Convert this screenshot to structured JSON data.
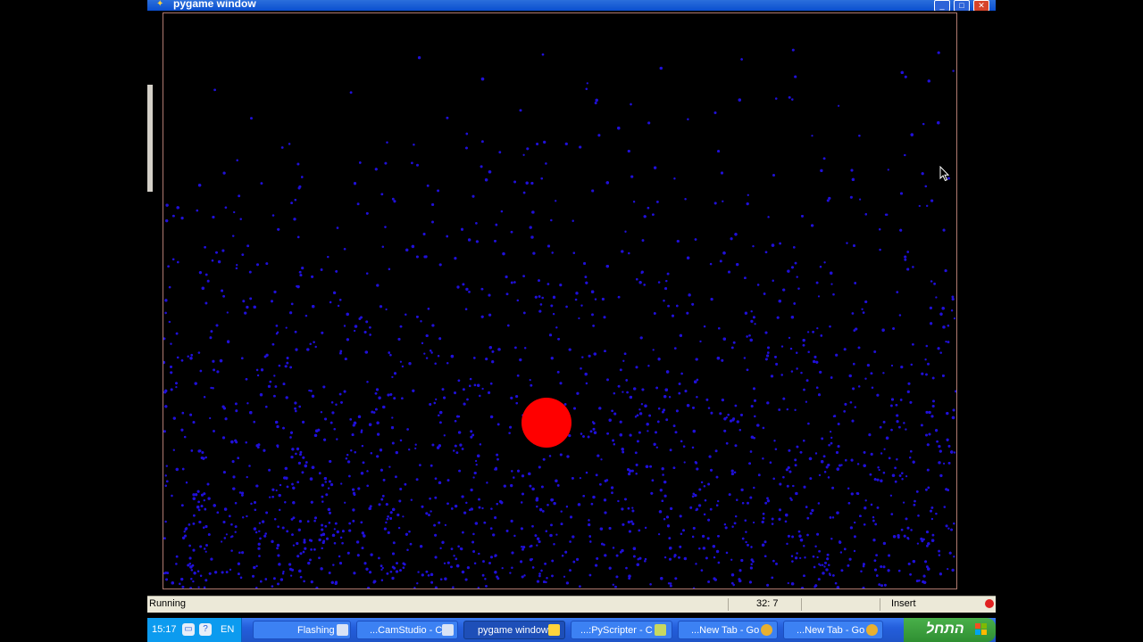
{
  "window": {
    "title": "pygame window",
    "controls": [
      "minimize",
      "maximize",
      "close"
    ]
  },
  "game": {
    "background": "#000000",
    "particle_color": "#2010d8",
    "ball_color": "#ff0000",
    "icons": {
      "cursor": "arrow-cursor-icon",
      "ball": "red-ball"
    }
  },
  "statusbar": {
    "state": "Running",
    "position": "32: 7",
    "mode": "Insert"
  },
  "taskbar": {
    "clock": "15:17",
    "language": "EN",
    "start_label": "התחל",
    "buttons": [
      {
        "label": "Flashing",
        "active": false
      },
      {
        "label": "...CamStudio - C",
        "active": false
      },
      {
        "label": "pygame window",
        "active": true
      },
      {
        "label": "...:PyScripter - C",
        "active": false
      },
      {
        "label": "...New Tab - Go",
        "active": false
      },
      {
        "label": "...New Tab - Go",
        "active": false
      }
    ]
  }
}
